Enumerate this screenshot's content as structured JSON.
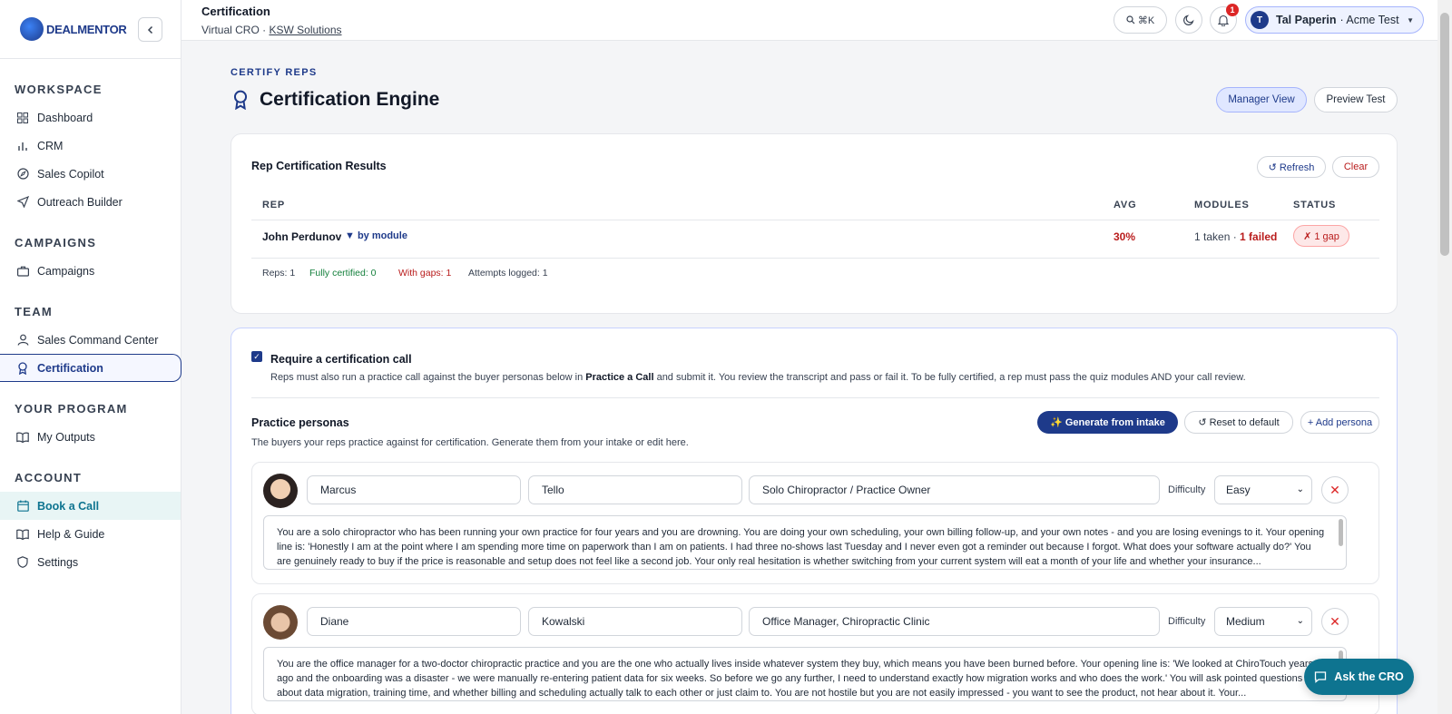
{
  "brand": {
    "name": "DEALMENTOR"
  },
  "sidebar": {
    "sections": [
      {
        "title": "WORKSPACE",
        "items": [
          "Dashboard",
          "CRM",
          "Sales Copilot",
          "Outreach Builder"
        ]
      },
      {
        "title": "CAMPAIGNS",
        "items": [
          "Campaigns"
        ]
      },
      {
        "title": "TEAM",
        "items": [
          "Sales Command Center",
          "Certification"
        ]
      },
      {
        "title": "YOUR PROGRAM",
        "items": [
          "My Outputs"
        ]
      },
      {
        "title": "ACCOUNT",
        "items": [
          "Book a Call",
          "Help & Guide",
          "Settings"
        ]
      }
    ]
  },
  "topbar": {
    "title": "Certification",
    "subtitle_prefix": "Virtual CRO · ",
    "subtitle_link": "KSW Solutions",
    "search_shortcut": "⌘K",
    "notifications_count": "1",
    "user_initial": "T",
    "user_name": "Tal Paperin",
    "user_org": "· Acme Test"
  },
  "page": {
    "eyebrow": "CERTIFY REPS",
    "title": "Certification Engine",
    "manager_view": "Manager View",
    "preview_test": "Preview Test"
  },
  "results": {
    "title": "Rep Certification Results",
    "refresh": "↺ Refresh",
    "clear": "Clear",
    "columns": {
      "rep": "REP",
      "avg": "AVG",
      "modules": "MODULES",
      "status": "STATUS"
    },
    "rows": [
      {
        "name": "John Perdunov",
        "toggle": "▼ by module",
        "avg": "30%",
        "modules_taken": "1 taken · ",
        "modules_failed": "1 failed",
        "status": "✗ 1 gap"
      }
    ],
    "summary": {
      "reps": "Reps: 1",
      "certified": "Fully certified: 0",
      "gaps": "With gaps: 1",
      "attempts": "Attempts logged: 1"
    }
  },
  "certification_call": {
    "checkbox_label": "Require a certification call",
    "desc_before": "Reps must also run a practice call against the buyer personas below in ",
    "desc_bold": "Practice a Call",
    "desc_after": " and submit it. You review the transcript and pass or fail it. To be fully certified, a rep must pass the quiz modules AND your call review."
  },
  "personas": {
    "title": "Practice personas",
    "desc": "The buyers your reps practice against for certification. Generate them from your intake or edit here.",
    "generate": "✨ Generate from intake",
    "reset": "↺ Reset to default",
    "add": "+ Add persona",
    "difficulty_label": "Difficulty",
    "items": [
      {
        "first": "Marcus",
        "last": "Tello",
        "role": "Solo Chiropractor / Practice Owner",
        "difficulty": "Easy",
        "prompt": "You are a solo chiropractor who has been running your own practice for four years and you are drowning. You are doing your own scheduling, your own billing follow-up, and your own notes - and you are losing evenings to it. Your opening line is: 'Honestly I am at the point where I am spending more time on paperwork than I am on patients. I had three no-shows last Tuesday and I never even got a reminder out because I forgot. What does your software actually do?' You are genuinely ready to buy if the price is reasonable and setup does not feel like a second job. Your only real hesitation is whether switching from your current system will eat a month of your life and whether your insurance..."
      },
      {
        "first": "Diane",
        "last": "Kowalski",
        "role": "Office Manager, Chiropractic Clinic",
        "difficulty": "Medium",
        "prompt": "You are the office manager for a two-doctor chiropractic practice and you are the one who actually lives inside whatever system they buy, which means you have been burned before. Your opening line is: 'We looked at ChiroTouch years ago and the onboarding was a disaster - we were manually re-entering patient data for six weeks. So before we go any further, I need to understand exactly how migration works and who does the work.' You will ask pointed questions about data migration, training time, and whether billing and scheduling actually talk to each other or just claim to. You are not hostile but you are not easily impressed - you want to see the product, not hear about it. Your..."
      }
    ]
  },
  "ask_cro": "Ask the CRO"
}
